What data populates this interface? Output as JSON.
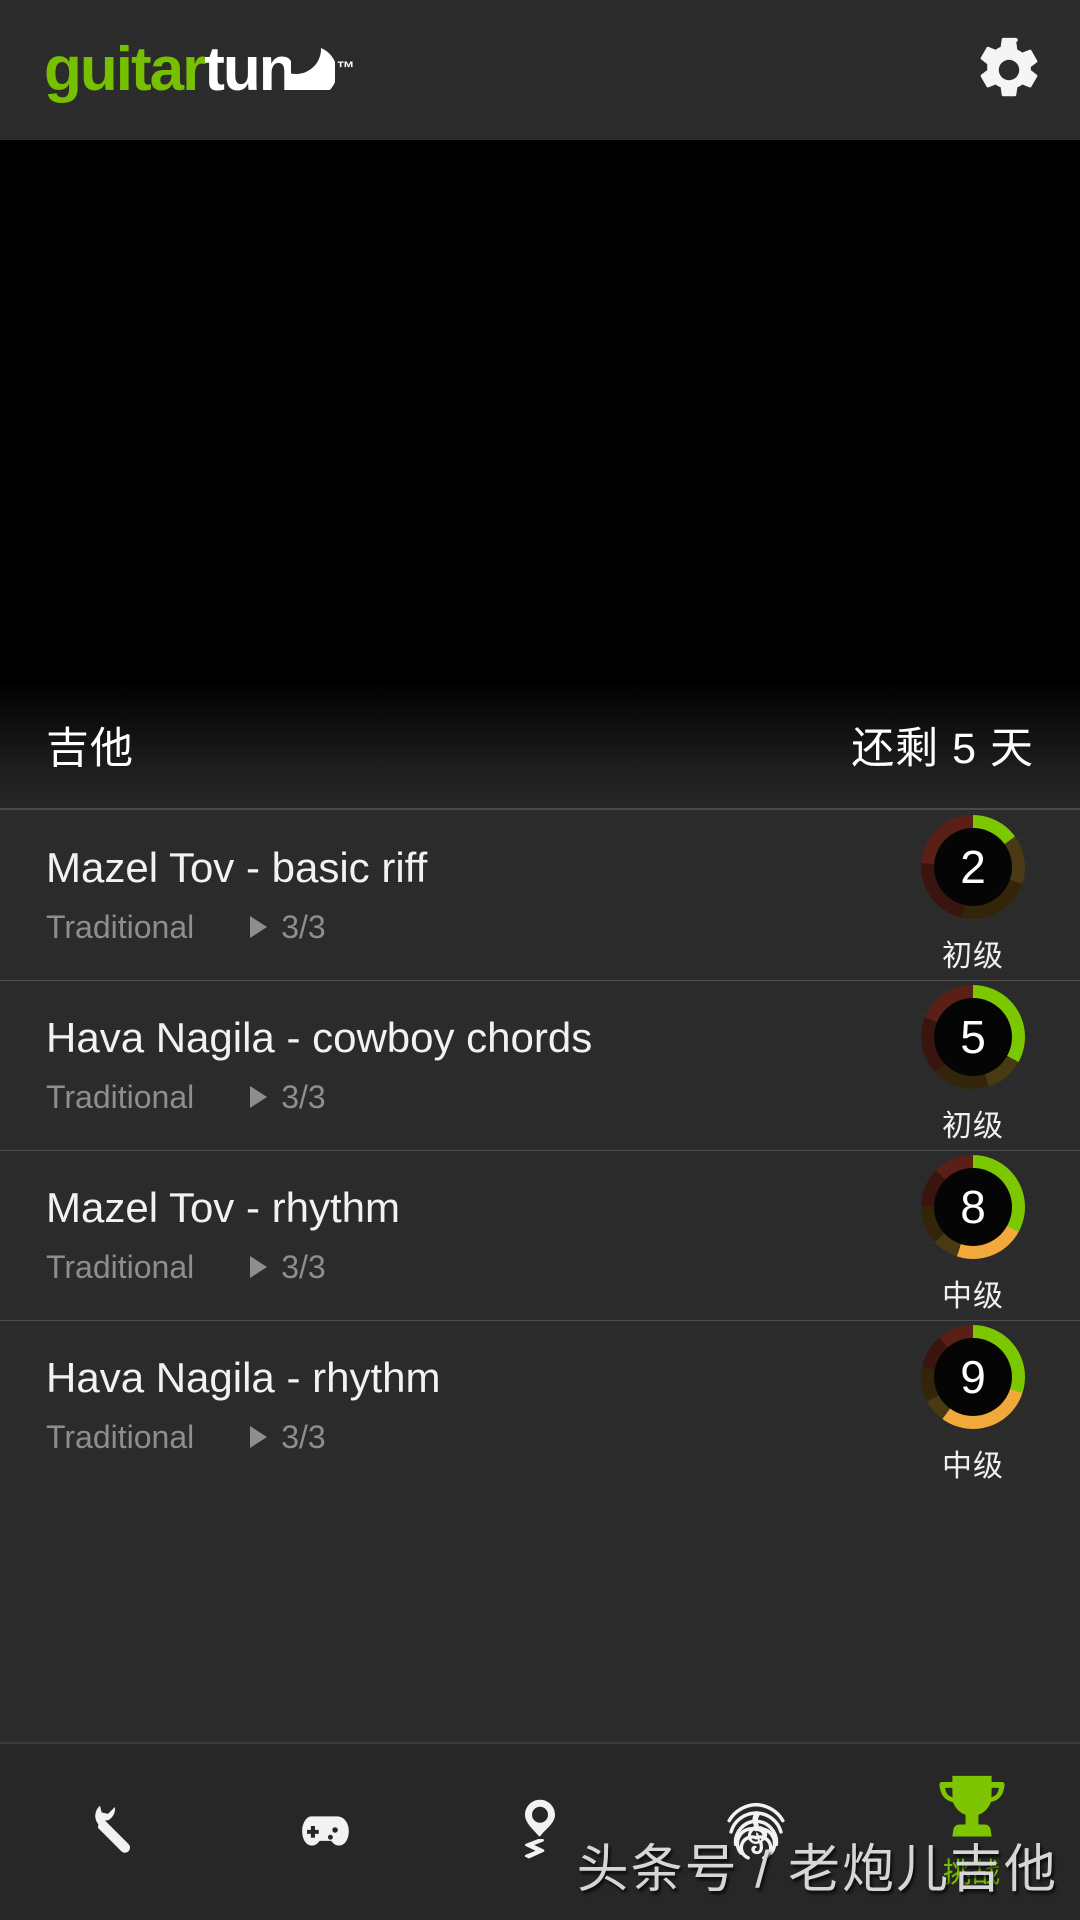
{
  "header": {
    "logo_primary": "guitar",
    "logo_secondary": "tun",
    "logo_tm": "™",
    "settings_icon": "gear-icon"
  },
  "section": {
    "title": "吉他",
    "trial_remaining": "还剩 5 天"
  },
  "songs": [
    {
      "title": "Mazel Tov - basic riff",
      "artist": "Traditional",
      "play_icon": "play-triangle-icon",
      "count": "3/3",
      "difficulty_number": "2",
      "difficulty_label": "初级",
      "ring_green_pct": 15,
      "ring_orange_pct": 0
    },
    {
      "title": "Hava Nagila - cowboy chords",
      "artist": "Traditional",
      "play_icon": "play-triangle-icon",
      "count": "3/3",
      "difficulty_number": "5",
      "difficulty_label": "初级",
      "ring_green_pct": 33,
      "ring_orange_pct": 0
    },
    {
      "title": "Mazel Tov - rhythm",
      "artist": "Traditional",
      "play_icon": "play-triangle-icon",
      "count": "3/3",
      "difficulty_number": "8",
      "difficulty_label": "中级",
      "ring_green_pct": 33,
      "ring_orange_pct": 22
    },
    {
      "title": "Hava Nagila - rhythm",
      "artist": "Traditional",
      "play_icon": "play-triangle-icon",
      "count": "3/3",
      "difficulty_number": "9",
      "difficulty_label": "中级",
      "ring_green_pct": 30,
      "ring_orange_pct": 30
    }
  ],
  "bottom_nav": [
    {
      "icon": "wrench-icon",
      "label": "",
      "active": false
    },
    {
      "icon": "gamepad-icon",
      "label": "",
      "active": false
    },
    {
      "icon": "metronome-pitch-icon",
      "label": "",
      "active": false
    },
    {
      "icon": "fingerprint-treble-clef-icon",
      "label": "",
      "active": false
    },
    {
      "icon": "trophy-icon",
      "label": "挑战",
      "active": true
    }
  ],
  "watermark": "头条号 / 老炮儿吉他",
  "colors": {
    "accent_green": "#76c000",
    "ring_green": "#7bc800",
    "ring_orange": "#f2a93b",
    "ring_dim_red": "#5a1f16",
    "ring_dim_olive": "#4a3a14",
    "list_bg": "#2a2a2a",
    "bar_bg": "#2b2b2b",
    "text_primary": "#f2f2f2",
    "text_secondary": "#8e8e8e"
  }
}
